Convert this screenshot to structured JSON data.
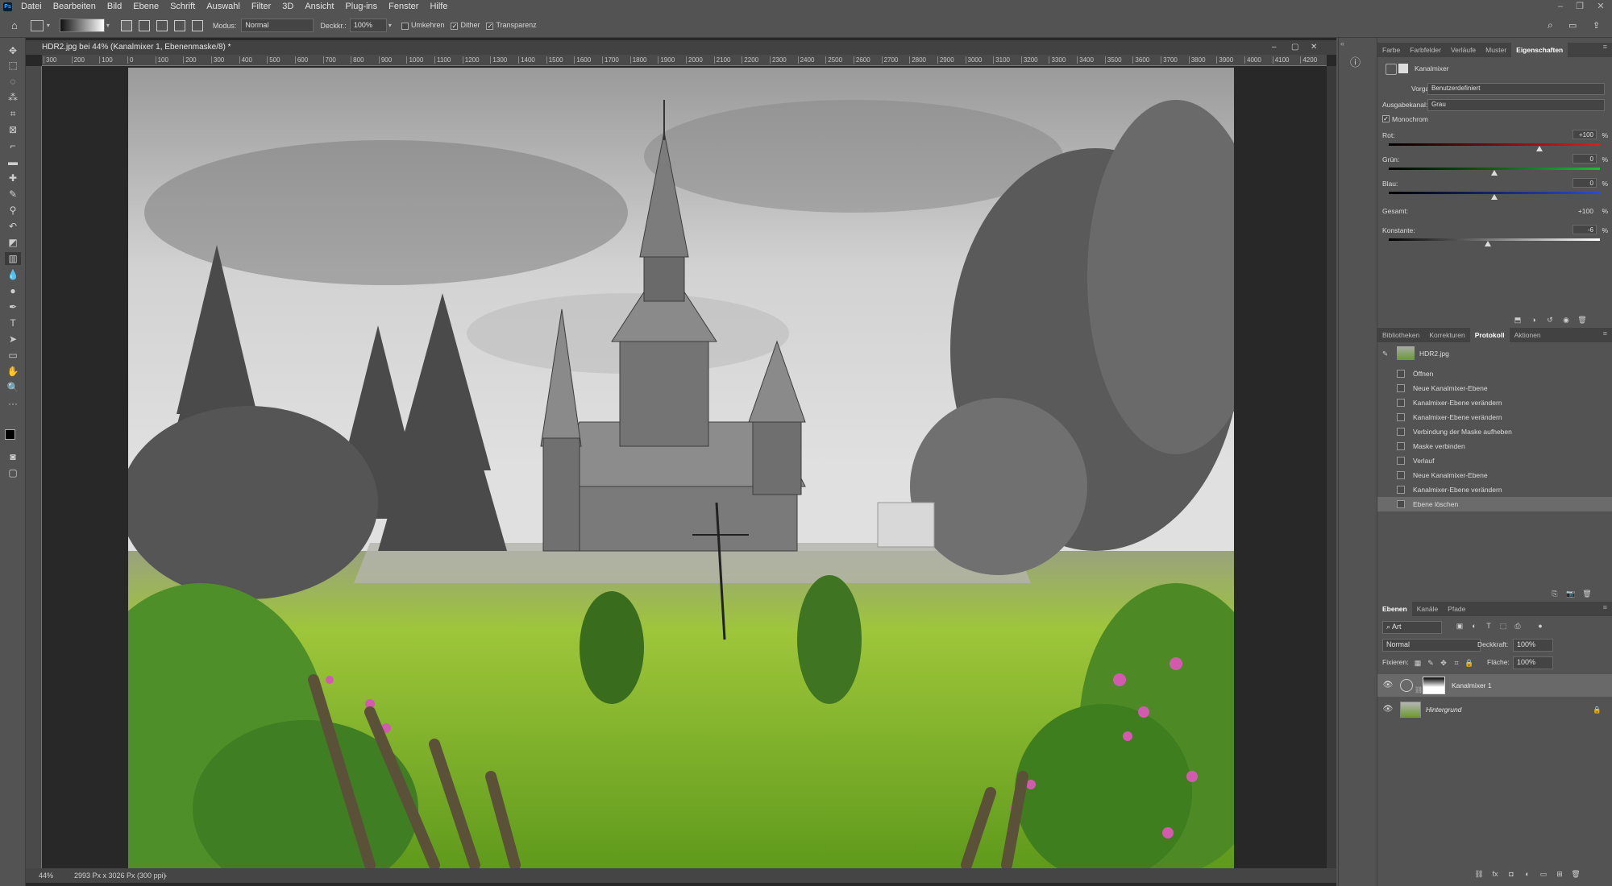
{
  "menu": [
    "Datei",
    "Bearbeiten",
    "Bild",
    "Ebene",
    "Schrift",
    "Auswahl",
    "Filter",
    "3D",
    "Ansicht",
    "Plug-ins",
    "Fenster",
    "Hilfe"
  ],
  "options": {
    "modus_label": "Modus:",
    "modus_value": "Normal",
    "deckkr_label": "Deckkr.:",
    "deckkr_value": "100%",
    "umkehren": "Umkehren",
    "dither": "Dither",
    "transparenz": "Transparenz"
  },
  "document": {
    "tab_title": "HDR2.jpg bei 44% (Kanalmixer 1, Ebenenmaske/8) *",
    "zoom": "44%",
    "doc_info": "2993 Px x 3026 Px (300 ppi)",
    "ruler_h": [
      "300",
      "200",
      "100",
      "0",
      "100",
      "200",
      "300",
      "400",
      "500",
      "600",
      "700",
      "800",
      "900",
      "1000",
      "1100",
      "1200",
      "1300",
      "1400",
      "1500",
      "1600",
      "1700",
      "1800",
      "1900",
      "2000",
      "2100",
      "2200",
      "2300",
      "2400",
      "2500",
      "2600",
      "2700",
      "2800",
      "2900",
      "3000",
      "3100",
      "3200",
      "3300",
      "3400",
      "3500",
      "3600",
      "3700",
      "3800",
      "3900",
      "4000",
      "4100",
      "4200"
    ]
  },
  "properties": {
    "tabs": [
      "Farbe",
      "Farbfelder",
      "Verläufe",
      "Muster",
      "Eigenschaften"
    ],
    "active_tab": "Eigenschaften",
    "title": "Kanalmixer",
    "vorgabe_label": "Vorgabe:",
    "vorgabe_value": "Benutzerdefiniert",
    "ausgabekanal_label": "Ausgabekanal:",
    "ausgabekanal_value": "Grau",
    "monochrom": "Monochrom",
    "rot_label": "Rot:",
    "rot_value": "+100",
    "gruen_label": "Grün:",
    "gruen_value": "0",
    "blau_label": "Blau:",
    "blau_value": "0",
    "gesamt_label": "Gesamt:",
    "gesamt_value": "+100",
    "konstante_label": "Konstante:",
    "konstante_value": "-6",
    "pct": "%"
  },
  "history": {
    "tabs": [
      "Bibliotheken",
      "Korrekturen",
      "Protokoll",
      "Aktionen"
    ],
    "active_tab": "Protokoll",
    "snapshot": "HDR2.jpg",
    "items": [
      "Öffnen",
      "Neue Kanalmixer-Ebene",
      "Kanalmixer-Ebene verändern",
      "Kanalmixer-Ebene verändern",
      "Verbindung der Maske aufheben",
      "Maske verbinden",
      "Verlauf",
      "Neue Kanalmixer-Ebene",
      "Kanalmixer-Ebene verändern",
      "Ebene löschen"
    ]
  },
  "layers": {
    "tabs": [
      "Ebenen",
      "Kanäle",
      "Pfade"
    ],
    "active_tab": "Ebenen",
    "filter_kind": "Art",
    "blend_mode": "Normal",
    "deckkraft_label": "Deckkraft:",
    "deckkraft_value": "100%",
    "fixieren_label": "Fixieren:",
    "flaeche_label": "Fläche:",
    "flaeche_value": "100%",
    "items": [
      {
        "name": "Kanalmixer 1"
      },
      {
        "name": "Hintergrund"
      }
    ]
  },
  "colors": {
    "accent": "#31a8ff",
    "panel_bg": "#535353",
    "canvas_bg": "#282828"
  }
}
